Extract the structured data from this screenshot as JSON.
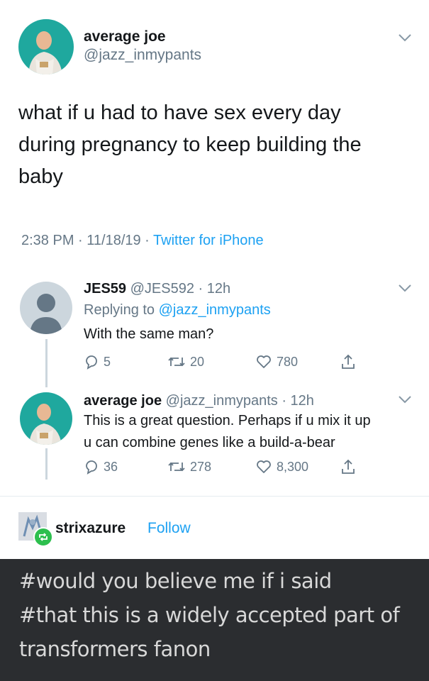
{
  "main_tweet": {
    "name": "average joe",
    "handle": "@jazz_inmypants",
    "text_lines": [
      "what if u had to have sex every day",
      "during pregnancy to keep building the",
      "baby"
    ],
    "timestamp": "2:38 PM · 11/18/19 · ",
    "source": "Twitter for iPhone"
  },
  "reply1": {
    "name": "JES59",
    "handle_time": " @JES592 · 12h",
    "replying_prefix": "Replying to ",
    "replying_handle": "@jazz_inmypants",
    "text": "With the same man?",
    "replies": "5",
    "retweets": "20",
    "likes": "780"
  },
  "reply2": {
    "name": "average joe",
    "handle_time": " @jazz_inmypants · 12h",
    "text_lines": [
      "This is a great question. Perhaps if u mix it up",
      "u can combine genes like a build-a-bear"
    ],
    "replies": "36",
    "retweets": "278",
    "likes": "8,300"
  },
  "tumblr": {
    "username": "strixazure",
    "follow_label": "Follow",
    "tags": [
      "#would you believe me if i said",
      "#that this is a widely accepted part of",
      "transformers fanon"
    ]
  },
  "colors": {
    "accent": "#1da1f2",
    "muted": "#657786",
    "avatar_bg": "#1fa89e",
    "tags_bg": "#2b2d30"
  }
}
